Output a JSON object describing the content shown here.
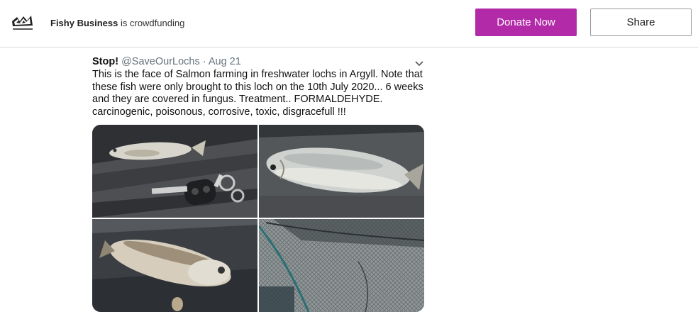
{
  "header": {
    "logo_icon": "fishy-business-logo-icon",
    "org_name": "Fishy Business",
    "status_text": " is crowdfunding",
    "donate_label": "Donate Now",
    "share_label": "Share",
    "donate_color": "#b32aa9"
  },
  "tweet": {
    "author": "Stop!",
    "handle": "@SaveOurLochs",
    "separator": "·",
    "date": "Aug 21",
    "menu_icon": "chevron-down-icon",
    "text": "This is the face of Salmon farming in freshwater lochs in Argyll. Note that these fish were only brought to this loch on the 10th July 2020... 6 weeks and they are covered in fungus. Treatment.. FORMALDEHYDE. carcinogenic, poisonous, corrosive, toxic, disgracefull !!!",
    "photos": [
      {
        "name": "dead-fish-with-car-key-photo"
      },
      {
        "name": "dead-fish-on-deck-photo"
      },
      {
        "name": "dead-fish-on-wet-boards-photo"
      },
      {
        "name": "fish-cage-net-photo"
      }
    ]
  }
}
